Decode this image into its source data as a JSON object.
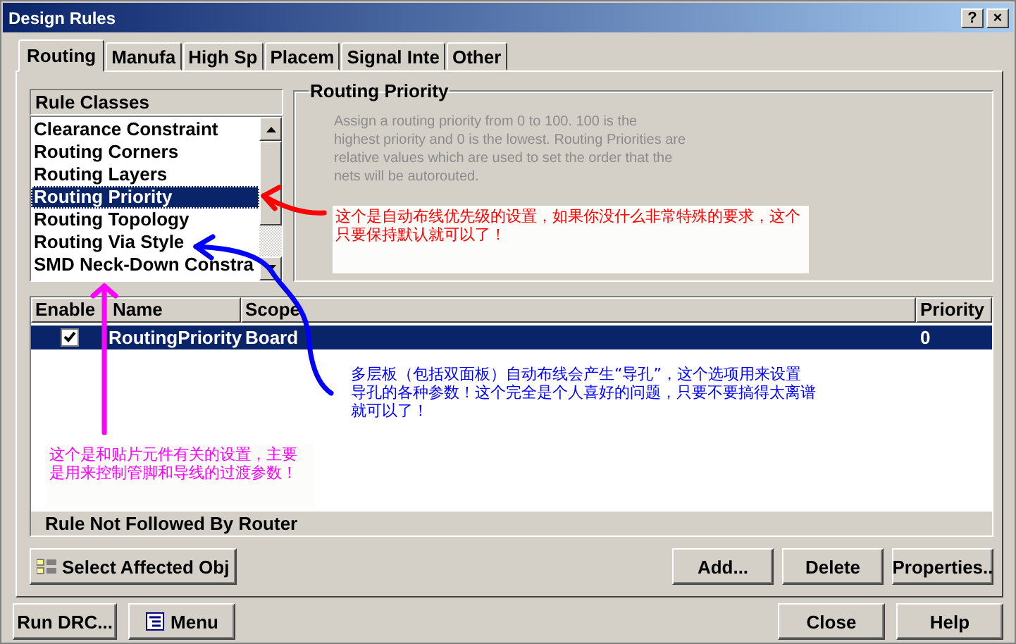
{
  "window": {
    "title": "Design Rules",
    "title_buttons": [
      "?",
      "×"
    ]
  },
  "tabs": [
    {
      "label": "Routing",
      "selected": true
    },
    {
      "label": "Manufa",
      "selected": false
    },
    {
      "label": "High Sp",
      "selected": false
    },
    {
      "label": "Placem",
      "selected": false
    },
    {
      "label": "Signal Inte",
      "selected": false
    },
    {
      "label": "Other",
      "selected": false
    }
  ],
  "rule_classes": {
    "heading": "Rule Classes",
    "items": [
      {
        "label": "Clearance Constraint",
        "selected": false
      },
      {
        "label": "Routing Corners",
        "selected": false
      },
      {
        "label": "Routing Layers",
        "selected": false
      },
      {
        "label": "Routing Priority",
        "selected": true
      },
      {
        "label": "Routing Topology",
        "selected": false
      },
      {
        "label": "Routing Via Style",
        "selected": false
      },
      {
        "label": "SMD Neck-Down Constra",
        "selected": false
      }
    ]
  },
  "group": {
    "title": "Routing Priority",
    "description": "Assign a routing priority from 0 to 100. 100 is the highest priority and 0 is the lowest. Routing Priorities are relative values which are used to set the order that the nets will be autorouted."
  },
  "table": {
    "columns": [
      "Enable",
      "Name",
      "Scope",
      "Priority"
    ],
    "rows": [
      {
        "enabled": true,
        "name": "RoutingPriority",
        "scope": "Board",
        "priority": "0",
        "selected": true
      }
    ],
    "footer": "Rule Not Followed By Router"
  },
  "buttons": [
    {
      "label": "Select Affected Obj",
      "kind": "icon"
    },
    {
      "label": "Add...",
      "kind": "plain"
    },
    {
      "label": "Delete",
      "kind": "plain"
    },
    {
      "label": "Properties..",
      "kind": "plain"
    }
  ],
  "footer_buttons": [
    {
      "label": "Run DRC...",
      "kind": "plain"
    },
    {
      "label": "Menu",
      "kind": "icon"
    },
    {
      "label": "Close",
      "kind": "plain"
    },
    {
      "label": "Help",
      "kind": "plain"
    }
  ],
  "annotations": [
    {
      "text": "这个是自动布线优先级的设置，如果你没什么非常特殊的要求，这个只要保持默认就可以了！",
      "color": "#ff0000",
      "boxed": true
    },
    {
      "text": "多层板（包括双面板）自动布线会产生“导孔”，这个选项用来设置导孔的各种参数！这个完全是个人喜好的问题，只要不要搞得太离谱就可以了！",
      "color": "#0000ff",
      "boxed": false
    },
    {
      "text": "这个是和贴片元件有关的设置，主要是用来控制管脚和导线的过渡参数！",
      "color": "#ff00ff",
      "boxed": true
    }
  ]
}
